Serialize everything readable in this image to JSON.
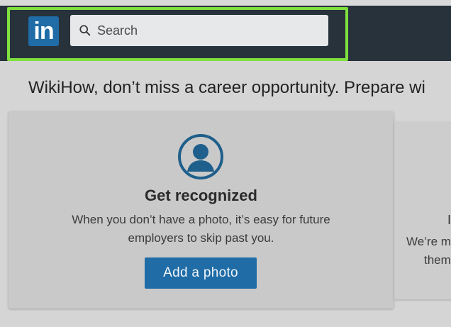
{
  "header": {
    "logo_text": "in",
    "search": {
      "placeholder": "Search",
      "icon": "search-icon"
    },
    "highlight_color": "#7fe03f"
  },
  "banner": {
    "headline": "WikiHow, don’t miss a career opportunity. Prepare wi"
  },
  "photo_card": {
    "icon": "person-avatar-icon",
    "title": "Get recognized",
    "description": "When you don’t have a photo, it’s easy for future employers to skip past you.",
    "button_label": "Add a photo"
  },
  "next_card": {
    "partial_title": "I",
    "line1": "We’re m",
    "line2": "them"
  },
  "colors": {
    "brand": "#1f6ca6",
    "topbar": "#27323b",
    "background": "#d5d5d5"
  }
}
